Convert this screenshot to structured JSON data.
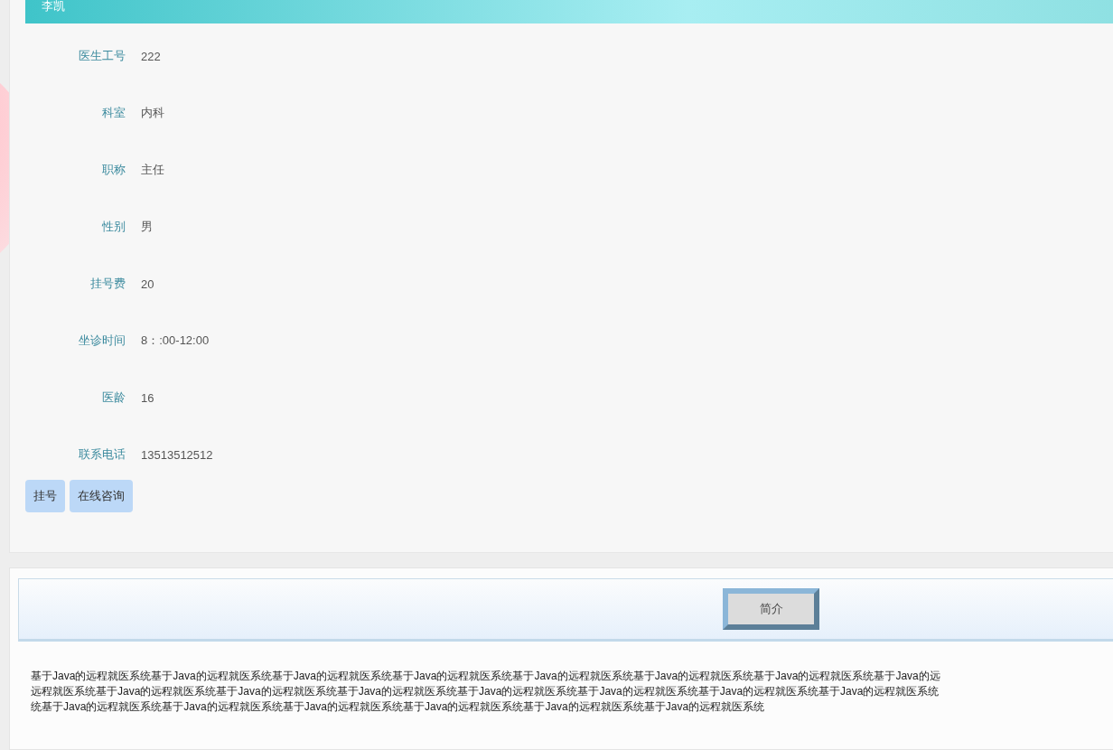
{
  "doctor": {
    "name": "李凯",
    "fields": [
      {
        "label": "医生工号",
        "value": "222"
      },
      {
        "label": "科室",
        "value": "内科"
      },
      {
        "label": "职称",
        "value": "主任"
      },
      {
        "label": "性别",
        "value": "男"
      },
      {
        "label": "挂号费",
        "value": "20"
      },
      {
        "label": "坐诊时间",
        "value": "8：:00-12:00"
      },
      {
        "label": "医龄",
        "value": "16"
      },
      {
        "label": "联系电话",
        "value": "13513512512"
      }
    ],
    "buttons": [
      "挂号",
      "在线咨询"
    ]
  },
  "intro": {
    "tabs": [
      {
        "label": "简介",
        "selected": true
      }
    ],
    "description_lines": [
      "基于Java的远程就医系统基于Java的远程就医系统基于Java的远程就医系统基于Java的远程就医系统基于Java的远程就医系统基于Java的远程就医系统基于Java的远程就医系统基于Java的远",
      "远程就医系统基于Java的远程就医系统基于Java的远程就医系统基于Java的远程就医系统基于Java的远程就医系统基于Java的远程就医系统基于Java的远程就医系统基于Java的远程就医系统",
      "统基于Java的远程就医系统基于Java的远程就医系统基于Java的远程就医系统基于Java的远程就医系统基于Java的远程就医系统基于Java的远程就医系统"
    ]
  }
}
